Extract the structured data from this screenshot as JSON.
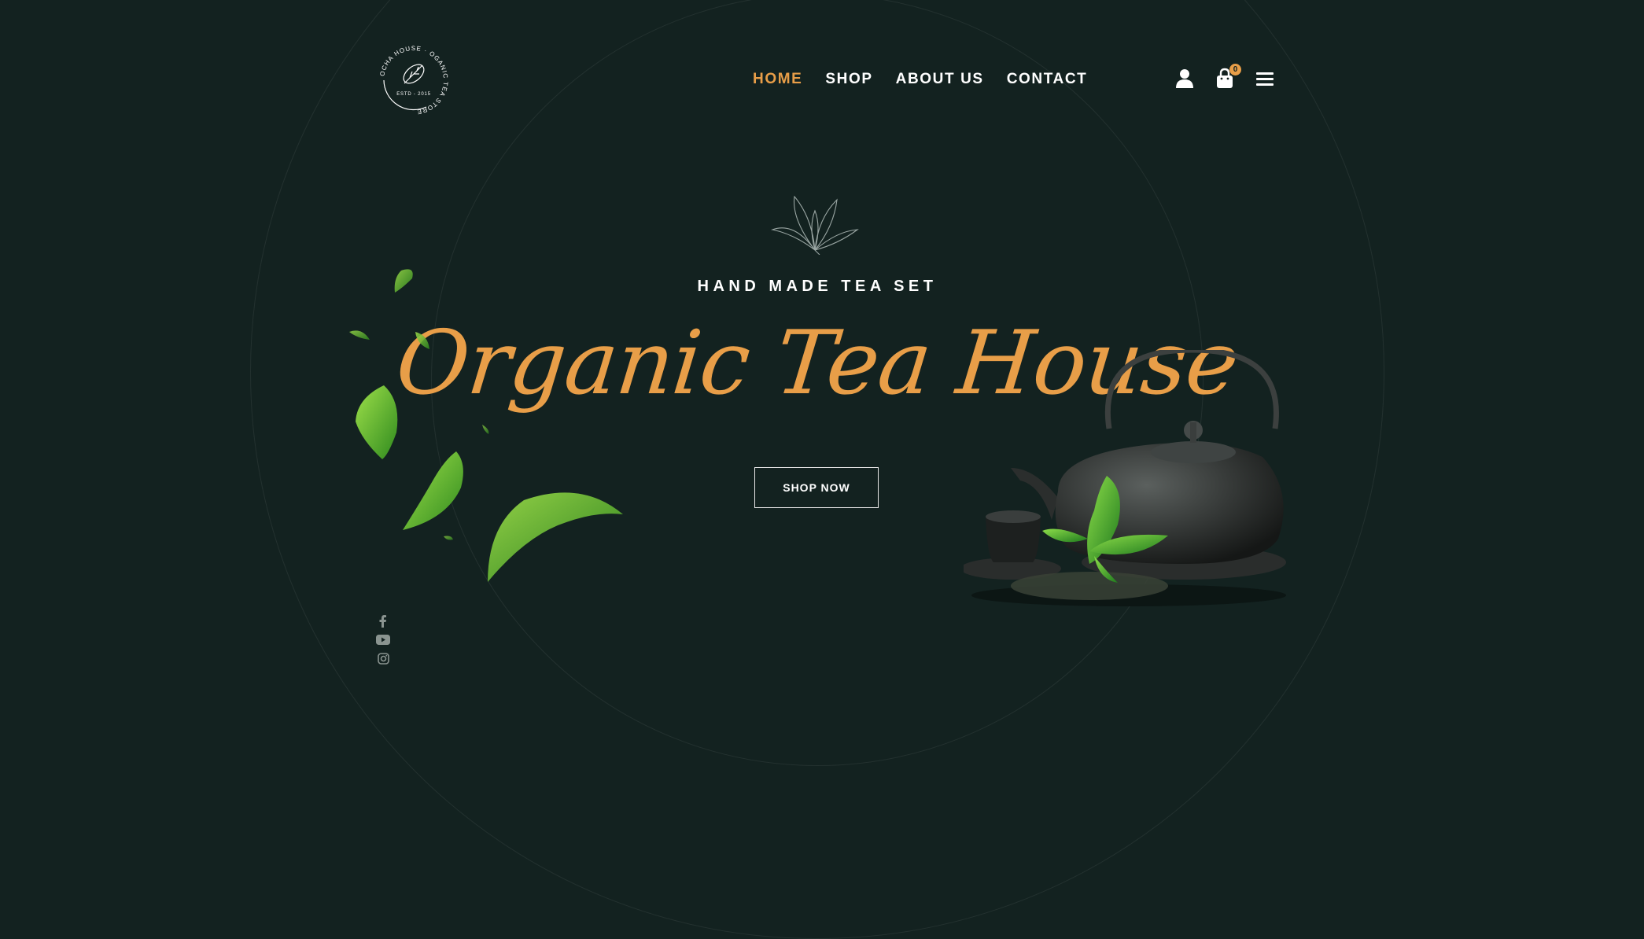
{
  "logo": {
    "ring_text": "OCHA HOUSE · OGANIC TEA STORE",
    "est": "ESTD - 2015"
  },
  "nav": {
    "items": [
      {
        "label": "HOME"
      },
      {
        "label": "SHOP"
      },
      {
        "label": "ABOUT US"
      },
      {
        "label": "CONTACT"
      }
    ]
  },
  "cart": {
    "count": "0"
  },
  "icons": {
    "user": "user-icon",
    "cart": "cart-icon",
    "menu": "hamburger-menu-icon"
  },
  "hero": {
    "subtitle": "HAND MADE TEA SET",
    "title": "Organic Tea House",
    "cta": "SHOP NOW",
    "decor": "tea-leaf-sketch-icon"
  },
  "social": {
    "items": [
      "facebook-icon",
      "youtube-icon",
      "instagram-icon"
    ]
  },
  "colors": {
    "background": "#132220",
    "accent": "#e89e48",
    "text": "#ffffff",
    "muted": "#8a9490"
  }
}
